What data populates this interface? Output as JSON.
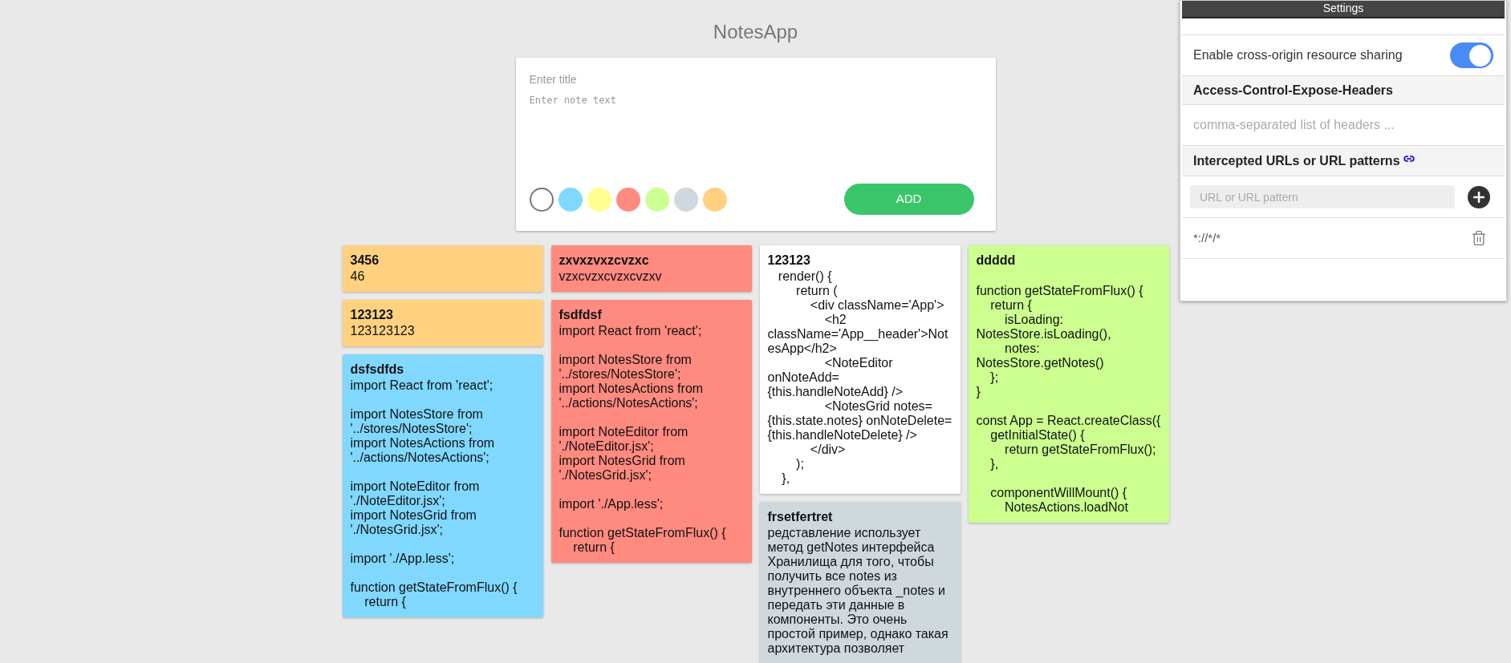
{
  "app_title": "NotesApp",
  "editor": {
    "title_placeholder": "Enter title",
    "text_placeholder": "Enter note text",
    "add_label": "ADD",
    "swatches": [
      {
        "color": "#ffffff",
        "selected": true
      },
      {
        "color": "#80d8ff",
        "selected": false
      },
      {
        "color": "#ffff8d",
        "selected": false
      },
      {
        "color": "#ff8a80",
        "selected": false
      },
      {
        "color": "#ccff90",
        "selected": false
      },
      {
        "color": "#cfd8dc",
        "selected": false
      },
      {
        "color": "#ffd180",
        "selected": false
      }
    ]
  },
  "columns": [
    {
      "notes": [
        {
          "title": "3456",
          "text": "46",
          "color": "#ffd180"
        },
        {
          "title": "123123",
          "text": "123123123",
          "color": "#ffd180"
        },
        {
          "title": "dsfsdfds",
          "text": "import React from 'react';\n\nimport NotesStore from '../stores/NotesStore';\nimport NotesActions from '../actions/NotesActions';\n\nimport NoteEditor from './NoteEditor.jsx';\nimport NotesGrid from './NotesGrid.jsx';\n\nimport './App.less';\n\nfunction getStateFromFlux() {\n    return {",
          "color": "#80d8ff"
        }
      ]
    },
    {
      "notes": [
        {
          "title": "zxvxzvxzcvzxc",
          "text": "vzxcvzxcvzxcvzxv",
          "color": "#ff8a80"
        },
        {
          "title": "fsdfdsf",
          "text": "import React from 'react';\n\nimport NotesStore from '../stores/NotesStore';\nimport NotesActions from '../actions/NotesActions';\n\nimport NoteEditor from './NoteEditor.jsx';\nimport NotesGrid from './NotesGrid.jsx';\n\nimport './App.less';\n\nfunction getStateFromFlux() {\n    return {",
          "color": "#ff8a80"
        }
      ]
    },
    {
      "notes": [
        {
          "title": "123123",
          "text": "   render() {\n        return (\n            <div className='App'>\n                <h2 className='App__header'>NotesApp</h2>\n                <NoteEditor onNoteAdd={this.handleNoteAdd} />\n                <NotesGrid notes={this.state.notes} onNoteDelete={this.handleNoteDelete} />\n            </div>\n        );\n    },",
          "color": "#ffffff"
        },
        {
          "title": "frsetfertret",
          "text": "редставление использует метод getNotes интерфейса Хранилища для того, чтобы получить все notes из внутреннего объекта _notes и передать эти данные в компоненты. Это очень простой пример, однако такая архитектура позволяет",
          "color": "#cfd8dc"
        }
      ]
    },
    {
      "notes": [
        {
          "title": "ddddd",
          "text": "\nfunction getStateFromFlux() {\n    return {\n        isLoading: NotesStore.isLoading(),\n        notes: NotesStore.getNotes()\n    };\n}\n\nconst App = React.createClass({\n    getInitialState() {\n        return getStateFromFlux();\n    },\n\n    componentWillMount() {\n        NotesActions.loadNot",
          "color": "#ccff90"
        }
      ]
    }
  ],
  "settings": {
    "title": "Settings",
    "cors": {
      "label": "Enable cross-origin resource sharing",
      "on": true
    },
    "expose_headers": {
      "heading": "Access-Control-Expose-Headers",
      "placeholder": "comma-separated list of headers ..."
    },
    "intercepted": {
      "heading": "Intercepted URLs or URL patterns",
      "placeholder": "URL or URL pattern",
      "entries": [
        "*://*/*"
      ]
    }
  }
}
